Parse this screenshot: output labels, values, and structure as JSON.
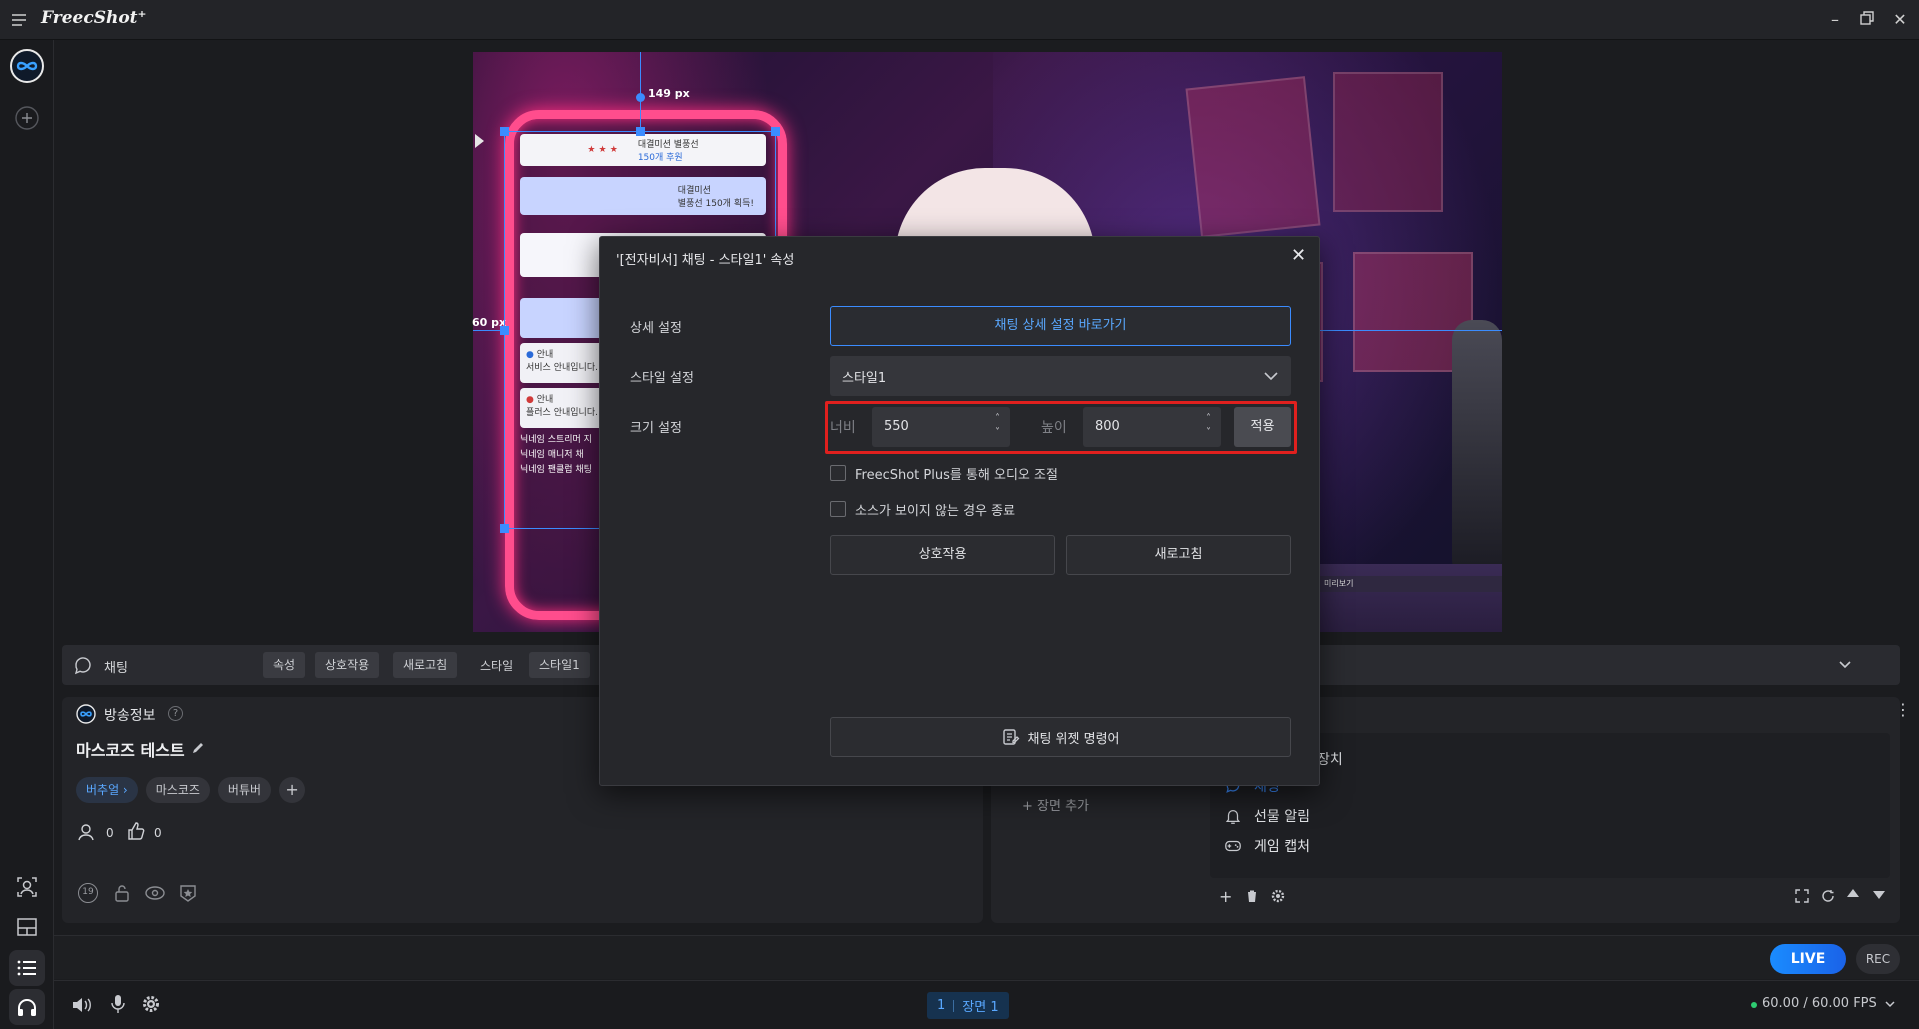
{
  "app": {
    "title": "FreecShot⁺"
  },
  "preview": {
    "measure_top": "149 px",
    "measure_left": "60 px",
    "chat_items": [
      {
        "line1": "대결미션 별풍선",
        "line2": "150개 후원"
      },
      {
        "line1": "대결미션",
        "line2": "별풍선 150개 획득!"
      },
      {
        "title": "안내",
        "text": "서비스 안내입니다."
      },
      {
        "title": "안내",
        "text": "플러스 안내입니다."
      }
    ],
    "chat_lines": [
      "닉네임 스트리머 지",
      "닉네임 매니저 채",
      "닉네임 팬클럽 채팅"
    ],
    "preview_tag": "미리보기"
  },
  "dialog": {
    "title": "'[전자비서] 채팅 - 스타일1' 속성",
    "rows": {
      "detail_label": "상세 설정",
      "detail_button": "채팅 상세 설정 바로가기",
      "style_label": "스타일 설정",
      "style_value": "스타일1",
      "size_label": "크기 설정",
      "width_label": "너비",
      "width_value": "550",
      "height_label": "높이",
      "height_value": "800",
      "apply_button": "적용"
    },
    "check_audio": "FreecShot Plus를 통해 오디오 조절",
    "check_exit": "소스가 보이지 않는 경우 종료",
    "interact_button": "상호작용",
    "refresh_button": "새로고침",
    "widget_command_button": "채팅 위젯 명령어"
  },
  "source_bar": {
    "name": "채팅",
    "buttons": [
      "속성",
      "상호작용",
      "새로고침"
    ],
    "style_label": "스타일",
    "style_value": "스타일1"
  },
  "info_panel": {
    "header": "방송정보",
    "title": "마스코즈 테스트",
    "tags": [
      "버추얼 ›",
      "마스코즈",
      "버튜버"
    ],
    "viewers": "0",
    "likes": "0",
    "age_badge": "19"
  },
  "scene_panel": {
    "add_scene": "+ 장면 추가",
    "sources": [
      "장치",
      "채팅",
      "선물 알림",
      "게임 캡처"
    ]
  },
  "footer": {
    "live_label": "LIVE",
    "rec_label": "REC",
    "scene_index": "1",
    "scene_name": "장면 1",
    "fps": "60.00 / 60.00 FPS"
  },
  "colors": {
    "accent": "#3b8cff",
    "live": "#1677ff",
    "highlight_box": "#e0201e",
    "fps_dot": "#2ecc71"
  }
}
